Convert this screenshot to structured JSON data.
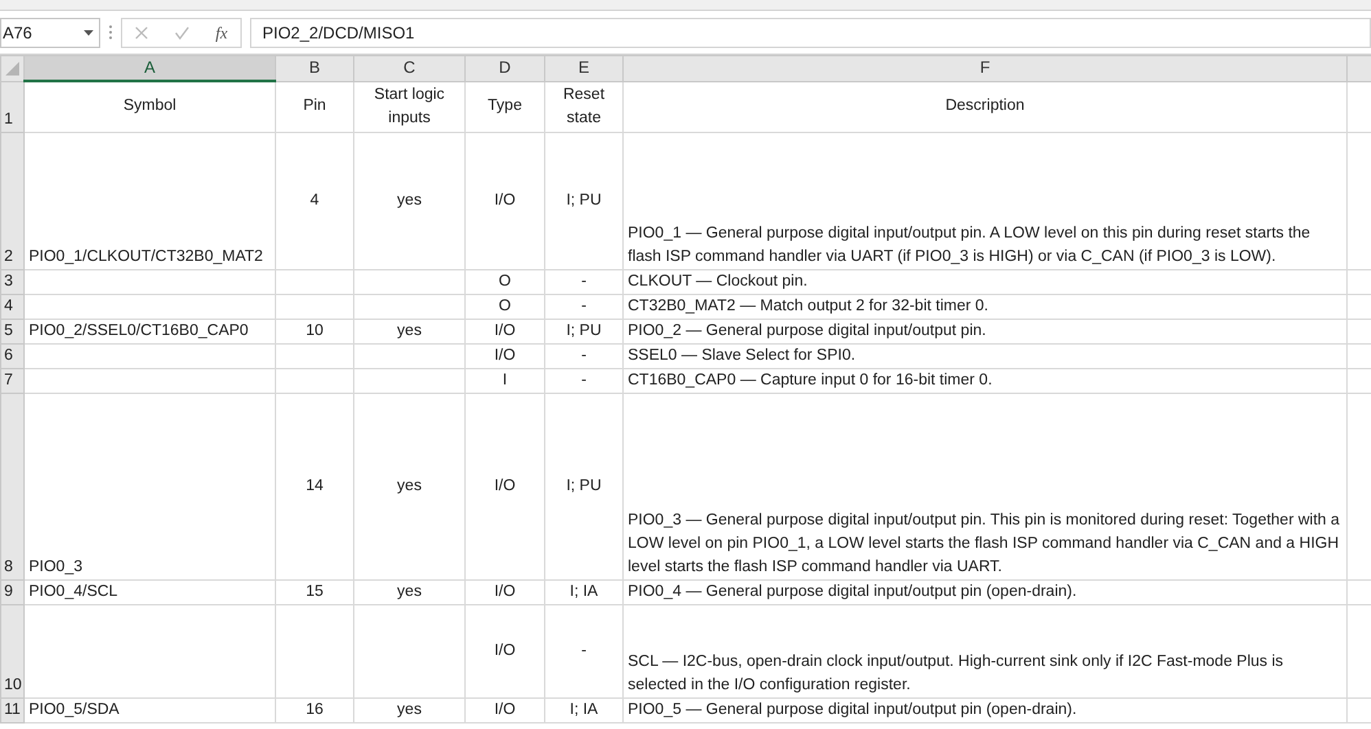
{
  "formula_bar": {
    "name_box": "A76",
    "function_label": "fx",
    "formula": "PIO2_2/DCD/MISO1"
  },
  "columns": [
    {
      "label": "A",
      "selected": true
    },
    {
      "label": "B",
      "selected": false
    },
    {
      "label": "C",
      "selected": false
    },
    {
      "label": "D",
      "selected": false
    },
    {
      "label": "E",
      "selected": false
    },
    {
      "label": "F",
      "selected": false
    }
  ],
  "rows": [
    {
      "number": "1",
      "cells": [
        "Symbol",
        "Pin",
        "Start logic inputs",
        "Type",
        "Reset state",
        "Description"
      ]
    },
    {
      "number": "2",
      "cells": [
        "PIO0_1/CLKOUT/CT32B0_MAT2",
        "4",
        "yes",
        "I/O",
        "I; PU",
        "PIO0_1 — General purpose digital input/output pin. A LOW level on this pin during reset starts the flash ISP command handler via UART (if PIO0_3 is HIGH) or via C_CAN (if PIO0_3 is LOW)."
      ]
    },
    {
      "number": "3",
      "cells": [
        "",
        "",
        "",
        "O",
        "-",
        "CLKOUT — Clockout pin."
      ]
    },
    {
      "number": "4",
      "cells": [
        "",
        "",
        "",
        "O",
        "-",
        "CT32B0_MAT2 — Match output 2 for 32-bit timer 0."
      ]
    },
    {
      "number": "5",
      "cells": [
        "PIO0_2/SSEL0/CT16B0_CAP0",
        "10",
        "yes",
        "I/O",
        "I; PU",
        "PIO0_2 — General purpose digital input/output pin."
      ]
    },
    {
      "number": "6",
      "cells": [
        "",
        "",
        "",
        "I/O",
        "-",
        "SSEL0 — Slave Select for SPI0."
      ]
    },
    {
      "number": "7",
      "cells": [
        "",
        "",
        "",
        "I",
        "-",
        "CT16B0_CAP0 — Capture input 0 for 16-bit timer 0."
      ]
    },
    {
      "number": "8",
      "cells": [
        "PIO0_3",
        "14",
        "yes",
        "I/O",
        "I; PU",
        "PIO0_3 — General purpose digital input/output pin. This pin is monitored during reset: Together with a LOW level on pin PIO0_1, a LOW level starts the flash ISP command handler via C_CAN and a HIGH level starts the flash ISP command handler via UART."
      ]
    },
    {
      "number": "9",
      "cells": [
        "PIO0_4/SCL",
        "15",
        "yes",
        "I/O",
        "I; IA",
        "PIO0_4 — General purpose digital input/output pin (open-drain)."
      ]
    },
    {
      "number": "10",
      "cells": [
        "",
        "",
        "",
        "I/O",
        "-",
        "SCL — I2C-bus, open-drain clock input/output. High-current sink only if I2C Fast-mode Plus is selected in the I/O configuration register."
      ]
    },
    {
      "number": "11",
      "cells": [
        "PIO0_5/SDA",
        "16",
        "yes",
        "I/O",
        "I; IA",
        "PIO0_5 — General purpose digital input/output pin (open-drain)."
      ]
    }
  ]
}
